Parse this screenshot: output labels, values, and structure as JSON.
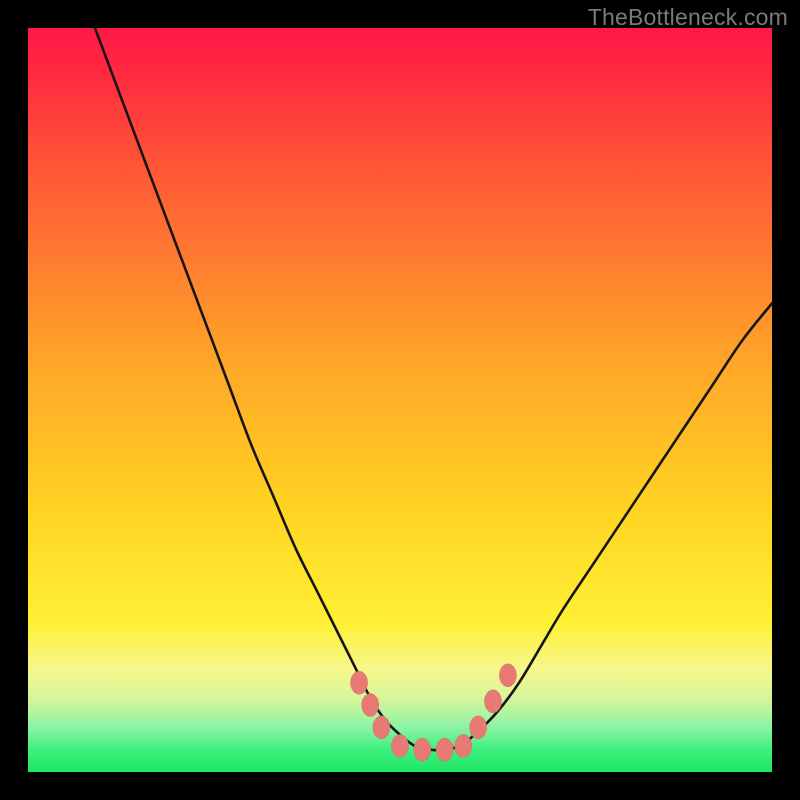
{
  "watermark": {
    "text": "TheBottleneck.com"
  },
  "colors": {
    "curve_stroke": "#161616",
    "marker_fill": "#e77a74",
    "marker_stroke": "#d96b64",
    "frame": "#000000"
  },
  "chart_data": {
    "type": "line",
    "title": "",
    "xlabel": "",
    "ylabel": "",
    "xlim": [
      0,
      100
    ],
    "ylim": [
      0,
      100
    ],
    "series": [
      {
        "name": "bottleneck-curve",
        "x": [
          9,
          12,
          15,
          18,
          21,
          24,
          27,
          30,
          33,
          36,
          39,
          42,
          44,
          46,
          48,
          50,
          52,
          54,
          56,
          58,
          60,
          63,
          66,
          69,
          72,
          76,
          80,
          84,
          88,
          92,
          96,
          100
        ],
        "y": [
          100,
          92,
          84,
          76,
          68,
          60,
          52,
          44,
          37,
          30,
          24,
          18,
          14,
          10,
          7,
          5,
          3.5,
          3,
          3,
          3.5,
          5,
          8,
          12,
          17,
          22,
          28,
          34,
          40,
          46,
          52,
          58,
          63
        ]
      }
    ],
    "markers": [
      {
        "x": 44.5,
        "y": 12.0
      },
      {
        "x": 46.0,
        "y": 9.0
      },
      {
        "x": 47.5,
        "y": 6.0
      },
      {
        "x": 50.0,
        "y": 3.5
      },
      {
        "x": 53.0,
        "y": 3.0
      },
      {
        "x": 56.0,
        "y": 3.0
      },
      {
        "x": 58.5,
        "y": 3.5
      },
      {
        "x": 60.5,
        "y": 6.0
      },
      {
        "x": 62.5,
        "y": 9.5
      },
      {
        "x": 64.5,
        "y": 13.0
      }
    ]
  }
}
